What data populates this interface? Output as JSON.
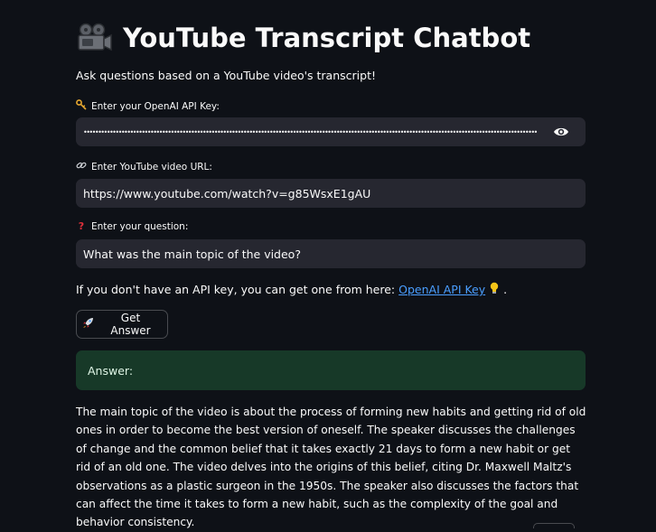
{
  "header": {
    "title": "YouTube Transcript Chatbot",
    "icon": "movie-camera-icon",
    "subtitle": "Ask questions based on a YouTube video's transcript!"
  },
  "form": {
    "api_key": {
      "label": "Enter your OpenAI API Key:",
      "icon": "key-icon",
      "masked_value": "••••••••••••••••••••••••••••••••••••••••••••••••••••••••••••••••••••••••••••••••••••••••••••••••••••••••••••••••••••••••••••••••••••••••••••••••••••••••••••",
      "toggle_icon": "eye-icon"
    },
    "video_url": {
      "label": "Enter YouTube video URL:",
      "icon": "link-icon",
      "value": "https://www.youtube.com/watch?v=g85WsxE1gAU"
    },
    "question": {
      "label": "Enter your question:",
      "icon": "question-mark-icon",
      "value": "What was the main topic of the video?"
    }
  },
  "info": {
    "text": "If you don't have an API key, you can get one from here:",
    "link_text": "OpenAI API Key",
    "icon": "lightbulb-icon",
    "suffix": "."
  },
  "button": {
    "label": "Get Answer",
    "icon": "rocket-icon"
  },
  "answer": {
    "label": "Answer:",
    "text": "The main topic of the video is about the process of forming new habits and getting rid of old ones in order to become the best version of oneself. The speaker discusses the challenges of change and the common belief that it takes exactly 21 days to form a new habit or get rid of an old one. The video delves into the origins of this belief, citing Dr. Maxwell Maltz's observations as a plastic surgeon in the 1950s. The speaker also discusses the factors that can affect the time it takes to form a new habit, such as the complexity of the goal and behavior consistency."
  },
  "colors": {
    "background": "#0e1117",
    "input_bg": "#262730",
    "link": "#4a9eff",
    "success_bg": "#173928"
  }
}
